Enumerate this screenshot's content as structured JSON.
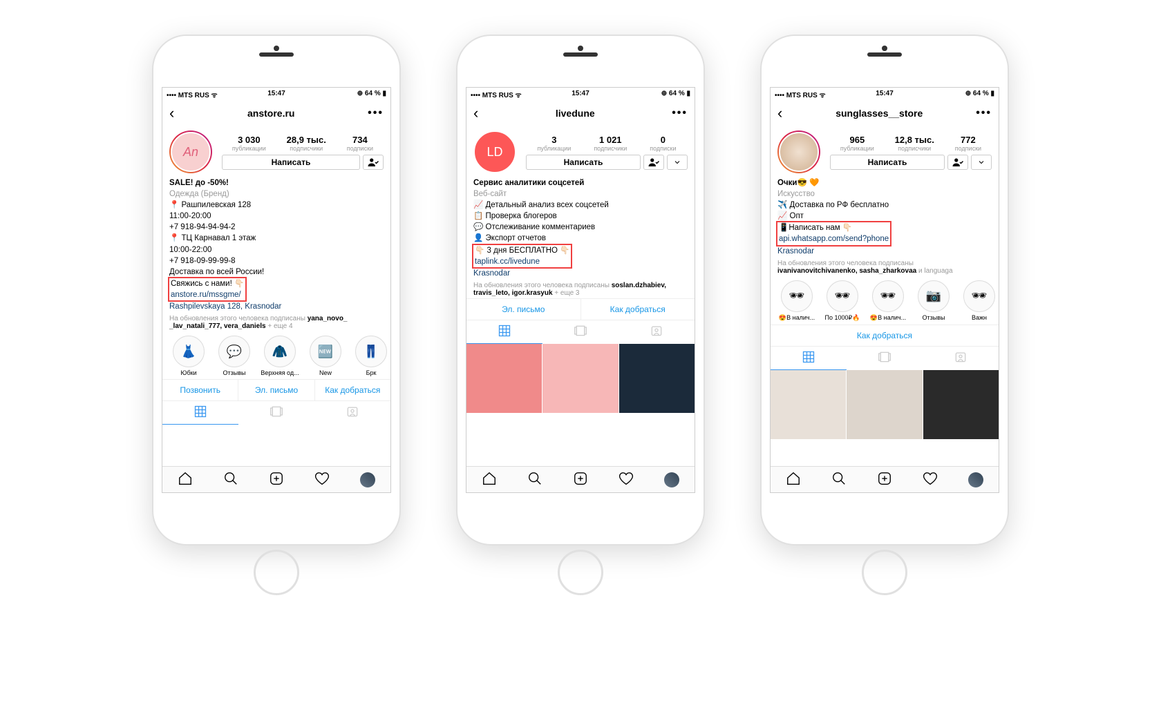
{
  "status": {
    "carrier": "MTS RUS",
    "time": "15:47",
    "battery": "64 %"
  },
  "common": {
    "btn_write": "Написать",
    "followed_prefix": "На обновления этого человека подписаны",
    "posts_lbl": "публикации",
    "followers_lbl": "подписчики",
    "following_lbl": "подписки",
    "actions": {
      "call": "Позвонить",
      "email": "Эл. письмо",
      "directions": "Как добраться"
    }
  },
  "phones": [
    {
      "username": "anstore.ru",
      "avatar_letters": "An",
      "avatar_style": "pink_ring",
      "stats": {
        "posts": "3 030",
        "followers": "28,9 тыс.",
        "following": "734"
      },
      "bio_name": "SALE! до -50%!",
      "bio_category": "Одежда (Бренд)",
      "bio_lines": [
        "📍 Рашпилевская 128",
        "11:00-20:00",
        "+7 918-94-94-94-2",
        "📍 ТЦ Карнавал 1 этаж",
        "10:00-22:00",
        "+7 918-09-99-99-8",
        "Доставка по всей России!"
      ],
      "boxed_text": "Свяжись с нами! 👇🏻",
      "boxed_link": "anstore.ru/mssgme/",
      "location": "Rashpilevskaya 128, Krasnodar",
      "followed_by": "yana_novo_ _lav_natali_777, vera_daniels",
      "followed_more": " + еще 4",
      "highlights": [
        {
          "label": "Юбки",
          "emoji": "👗"
        },
        {
          "label": "Отзывы",
          "emoji": "💬"
        },
        {
          "label": "Верхняя од...",
          "emoji": "🧥"
        },
        {
          "label": "New",
          "emoji": "🆕"
        },
        {
          "label": "Брк",
          "emoji": "👖"
        }
      ],
      "action_buttons": [
        "call",
        "email",
        "directions"
      ],
      "show_grid": false
    },
    {
      "username": "livedune",
      "avatar_letters": "LD",
      "avatar_style": "red",
      "stats": {
        "posts": "3",
        "followers": "1 021",
        "following": "0"
      },
      "bio_name": "Сервис аналитики соцсетей",
      "bio_category": "Веб-сайт",
      "bio_lines": [
        "📈 Детальный анализ всех соцсетей",
        "📋 Проверка блогеров",
        "💬 Отслеживание комментариев",
        "👤 Экспорт отчетов"
      ],
      "boxed_text": "👇🏻 3 дня БЕСПЛАТНО 👇🏻",
      "boxed_link": "taplink.cc/livedune",
      "location": "Krasnodar",
      "followed_by": "soslan.dzhabiev, travis_leto, igor.krasyuk",
      "followed_more": " + еще 3",
      "highlights": [],
      "action_buttons": [
        "email",
        "directions"
      ],
      "show_grid": true,
      "grid_colors": [
        "#f08a8a",
        "#f7b7b7",
        "#1b2a3a"
      ]
    },
    {
      "username": "sunglasses__store",
      "avatar_letters": "",
      "avatar_style": "img_ring",
      "stats": {
        "posts": "965",
        "followers": "12,8 тыс.",
        "following": "772"
      },
      "bio_name": "Очки😎 🧡",
      "bio_category": "Искусство",
      "bio_lines": [
        "✈️ Доставка по РФ бесплатно",
        "📈 Опт"
      ],
      "boxed_text": "📱Написать нам 👇🏻",
      "boxed_link": "api.whatsapp.com/send?phone",
      "location": "Krasnodar",
      "followed_by": "ivanivanovitchivanenko, sasha_zharkovaa",
      "followed_more": " и languaga",
      "highlights": [
        {
          "label": "😍В налич...",
          "emoji": "🕶"
        },
        {
          "label": "По 1000₽🔥",
          "emoji": "🕶"
        },
        {
          "label": "😍В налич...",
          "emoji": "🕶"
        },
        {
          "label": "Отзывы",
          "emoji": "📷"
        },
        {
          "label": "Важн",
          "emoji": "🕶"
        }
      ],
      "action_buttons": [
        "directions"
      ],
      "show_grid": true,
      "grid_colors": [
        "#e8e0d8",
        "#ddd5cc",
        "#2a2a2a"
      ]
    }
  ]
}
